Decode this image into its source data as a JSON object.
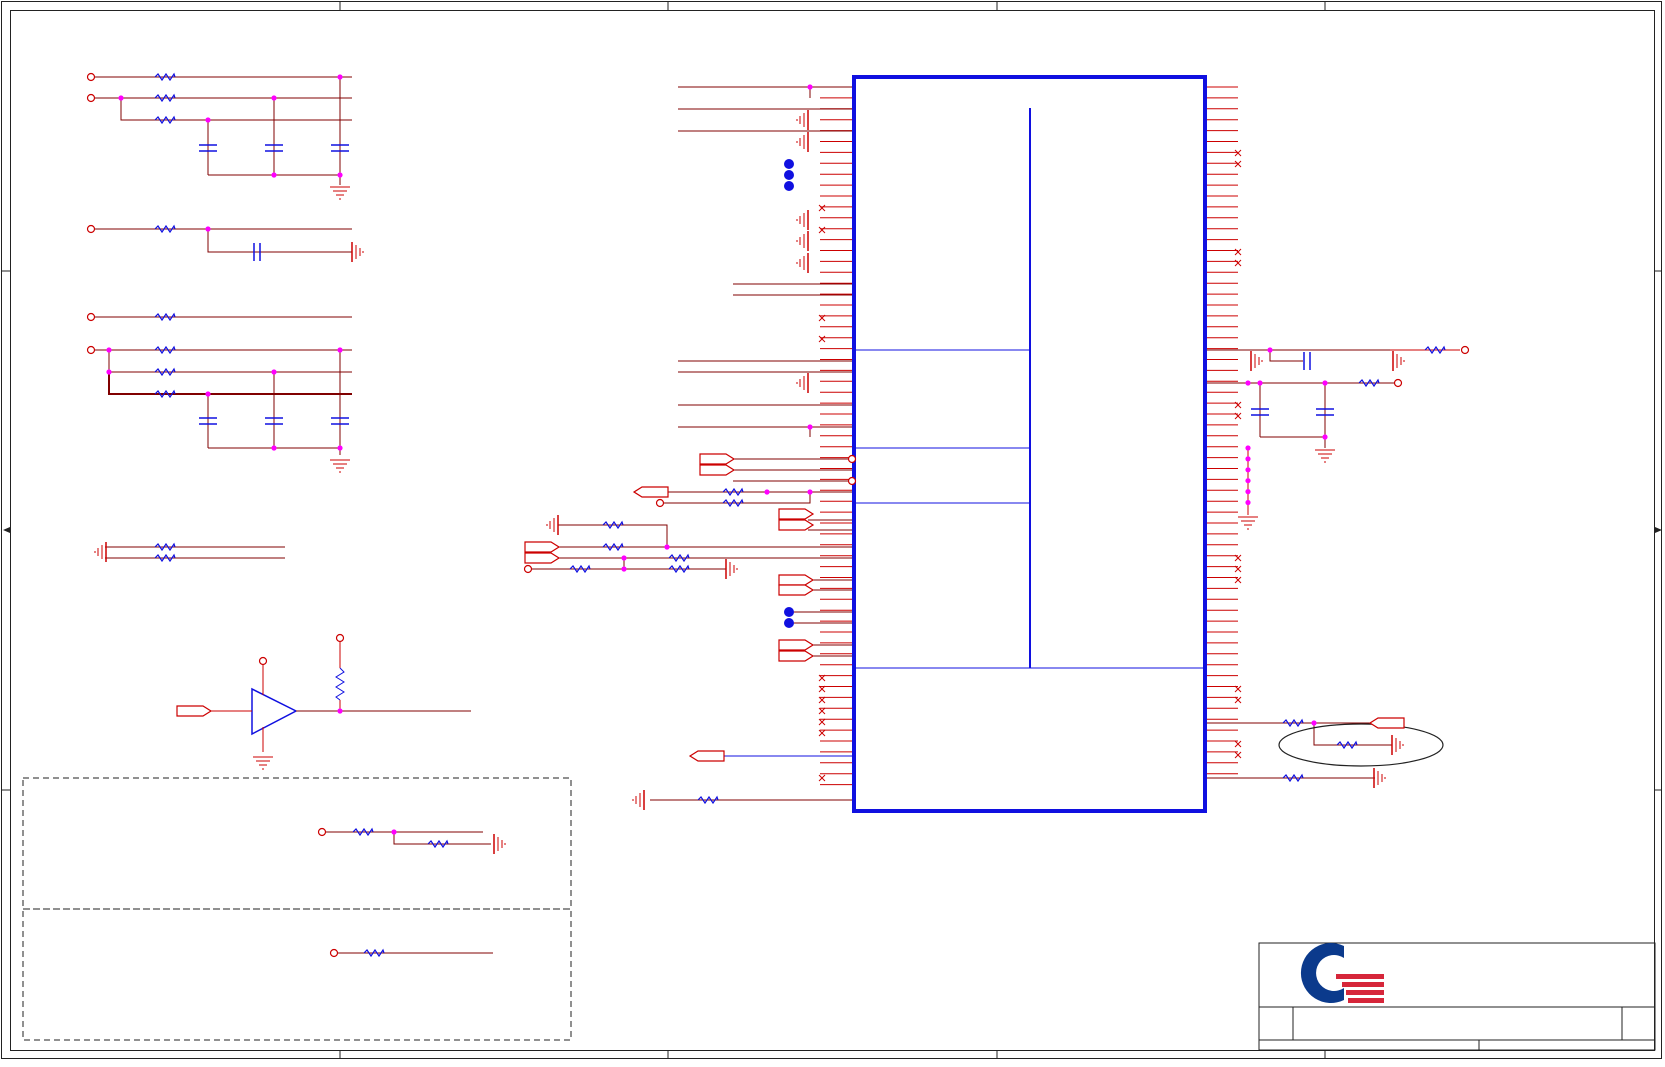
{
  "sheet": {
    "title": "",
    "colors": {
      "wire": "#cc0000",
      "net": "#800000",
      "component": "#1010e0",
      "junction": "#ff00ff",
      "frame": "#222222",
      "logo_blue": "#0b3a8c",
      "logo_red": "#d6263a"
    }
  },
  "title_block": {
    "logo": "company-logo"
  }
}
